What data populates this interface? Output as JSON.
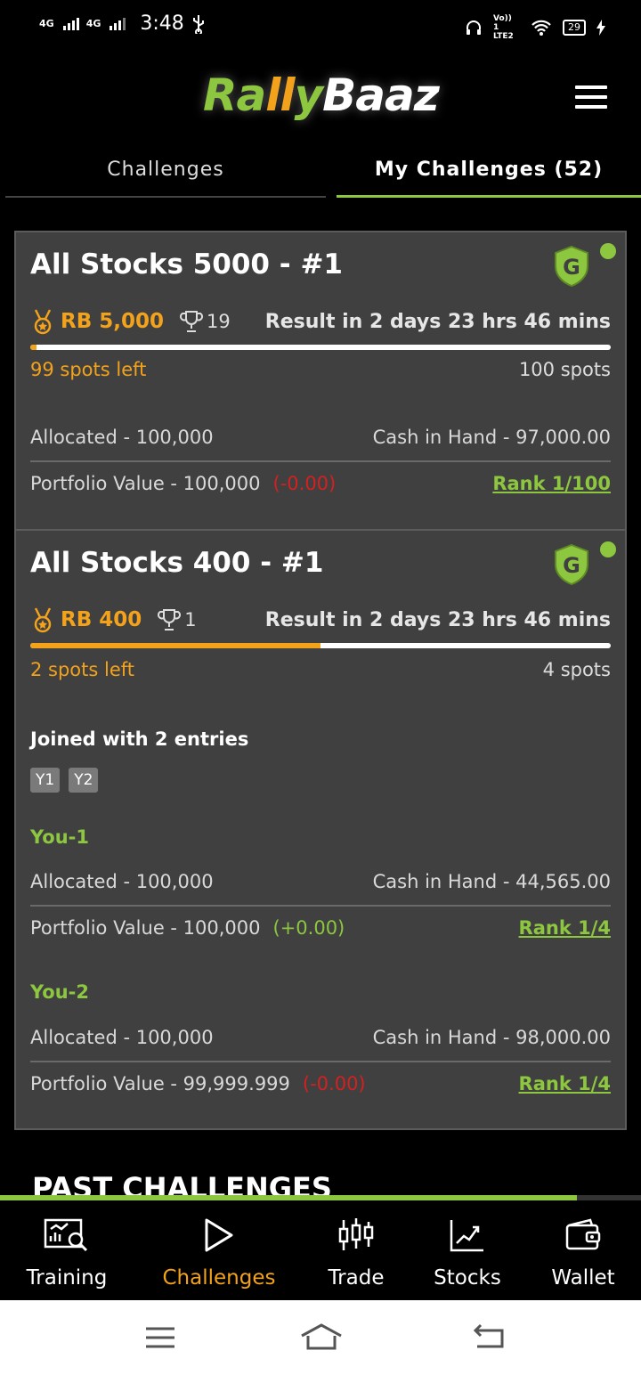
{
  "status_bar": {
    "network1": "4G",
    "network2": "4G",
    "time": "3:48",
    "volte": "Vo)) 1 LTE2",
    "battery": "29"
  },
  "app": {
    "logo_part1": "Ra",
    "logo_part2": "ll",
    "logo_part3": "y",
    "logo_part4": "Baaz"
  },
  "tabs": {
    "challenges": "Challenges",
    "my_challenges": "My Challenges (52)"
  },
  "cards": [
    {
      "title": "All Stocks 5000 - #1",
      "prize": "RB 5,000",
      "winners": "19",
      "result": "Result in 2 days 23 hrs 46 mins",
      "fill_fraction": 0.01,
      "spots_left": "99 spots left",
      "spots_total": "100 spots",
      "allocated": "Allocated - 100,000",
      "cash": "Cash in Hand - 97,000.00",
      "portfolio": "Portfolio Value - 100,000",
      "change": "(-0.00)",
      "rank": "Rank 1/100"
    },
    {
      "title": "All Stocks 400 - #1",
      "prize": "RB 400",
      "winners": "1",
      "result": "Result in 2 days 23 hrs 46 mins",
      "fill_fraction": 0.5,
      "spots_left": "2 spots left",
      "spots_total": "4 spots",
      "joined": "Joined with 2 entries",
      "chips": [
        "Y1",
        "Y2"
      ],
      "entries": [
        {
          "label": "You-1",
          "allocated": "Allocated - 100,000",
          "cash": "Cash in Hand - 44,565.00",
          "portfolio": "Portfolio Value - 100,000",
          "change": "(+0.00)",
          "rank": "Rank 1/4"
        },
        {
          "label": "You-2",
          "allocated": "Allocated - 100,000",
          "cash": "Cash in Hand - 98,000.00",
          "portfolio": "Portfolio Value - 99,999.999",
          "change": "(-0.00)",
          "rank": "Rank 1/4"
        }
      ]
    }
  ],
  "past_heading": "PAST CHALLENGES",
  "bottom_nav": {
    "training": "Training",
    "challenges": "Challenges",
    "trade": "Trade",
    "stocks": "Stocks",
    "wallet": "Wallet"
  },
  "colors": {
    "brand_green": "#8dc63f",
    "brand_orange": "#f3a21b",
    "negative_red": "#d42020",
    "card_bg": "#404040"
  }
}
